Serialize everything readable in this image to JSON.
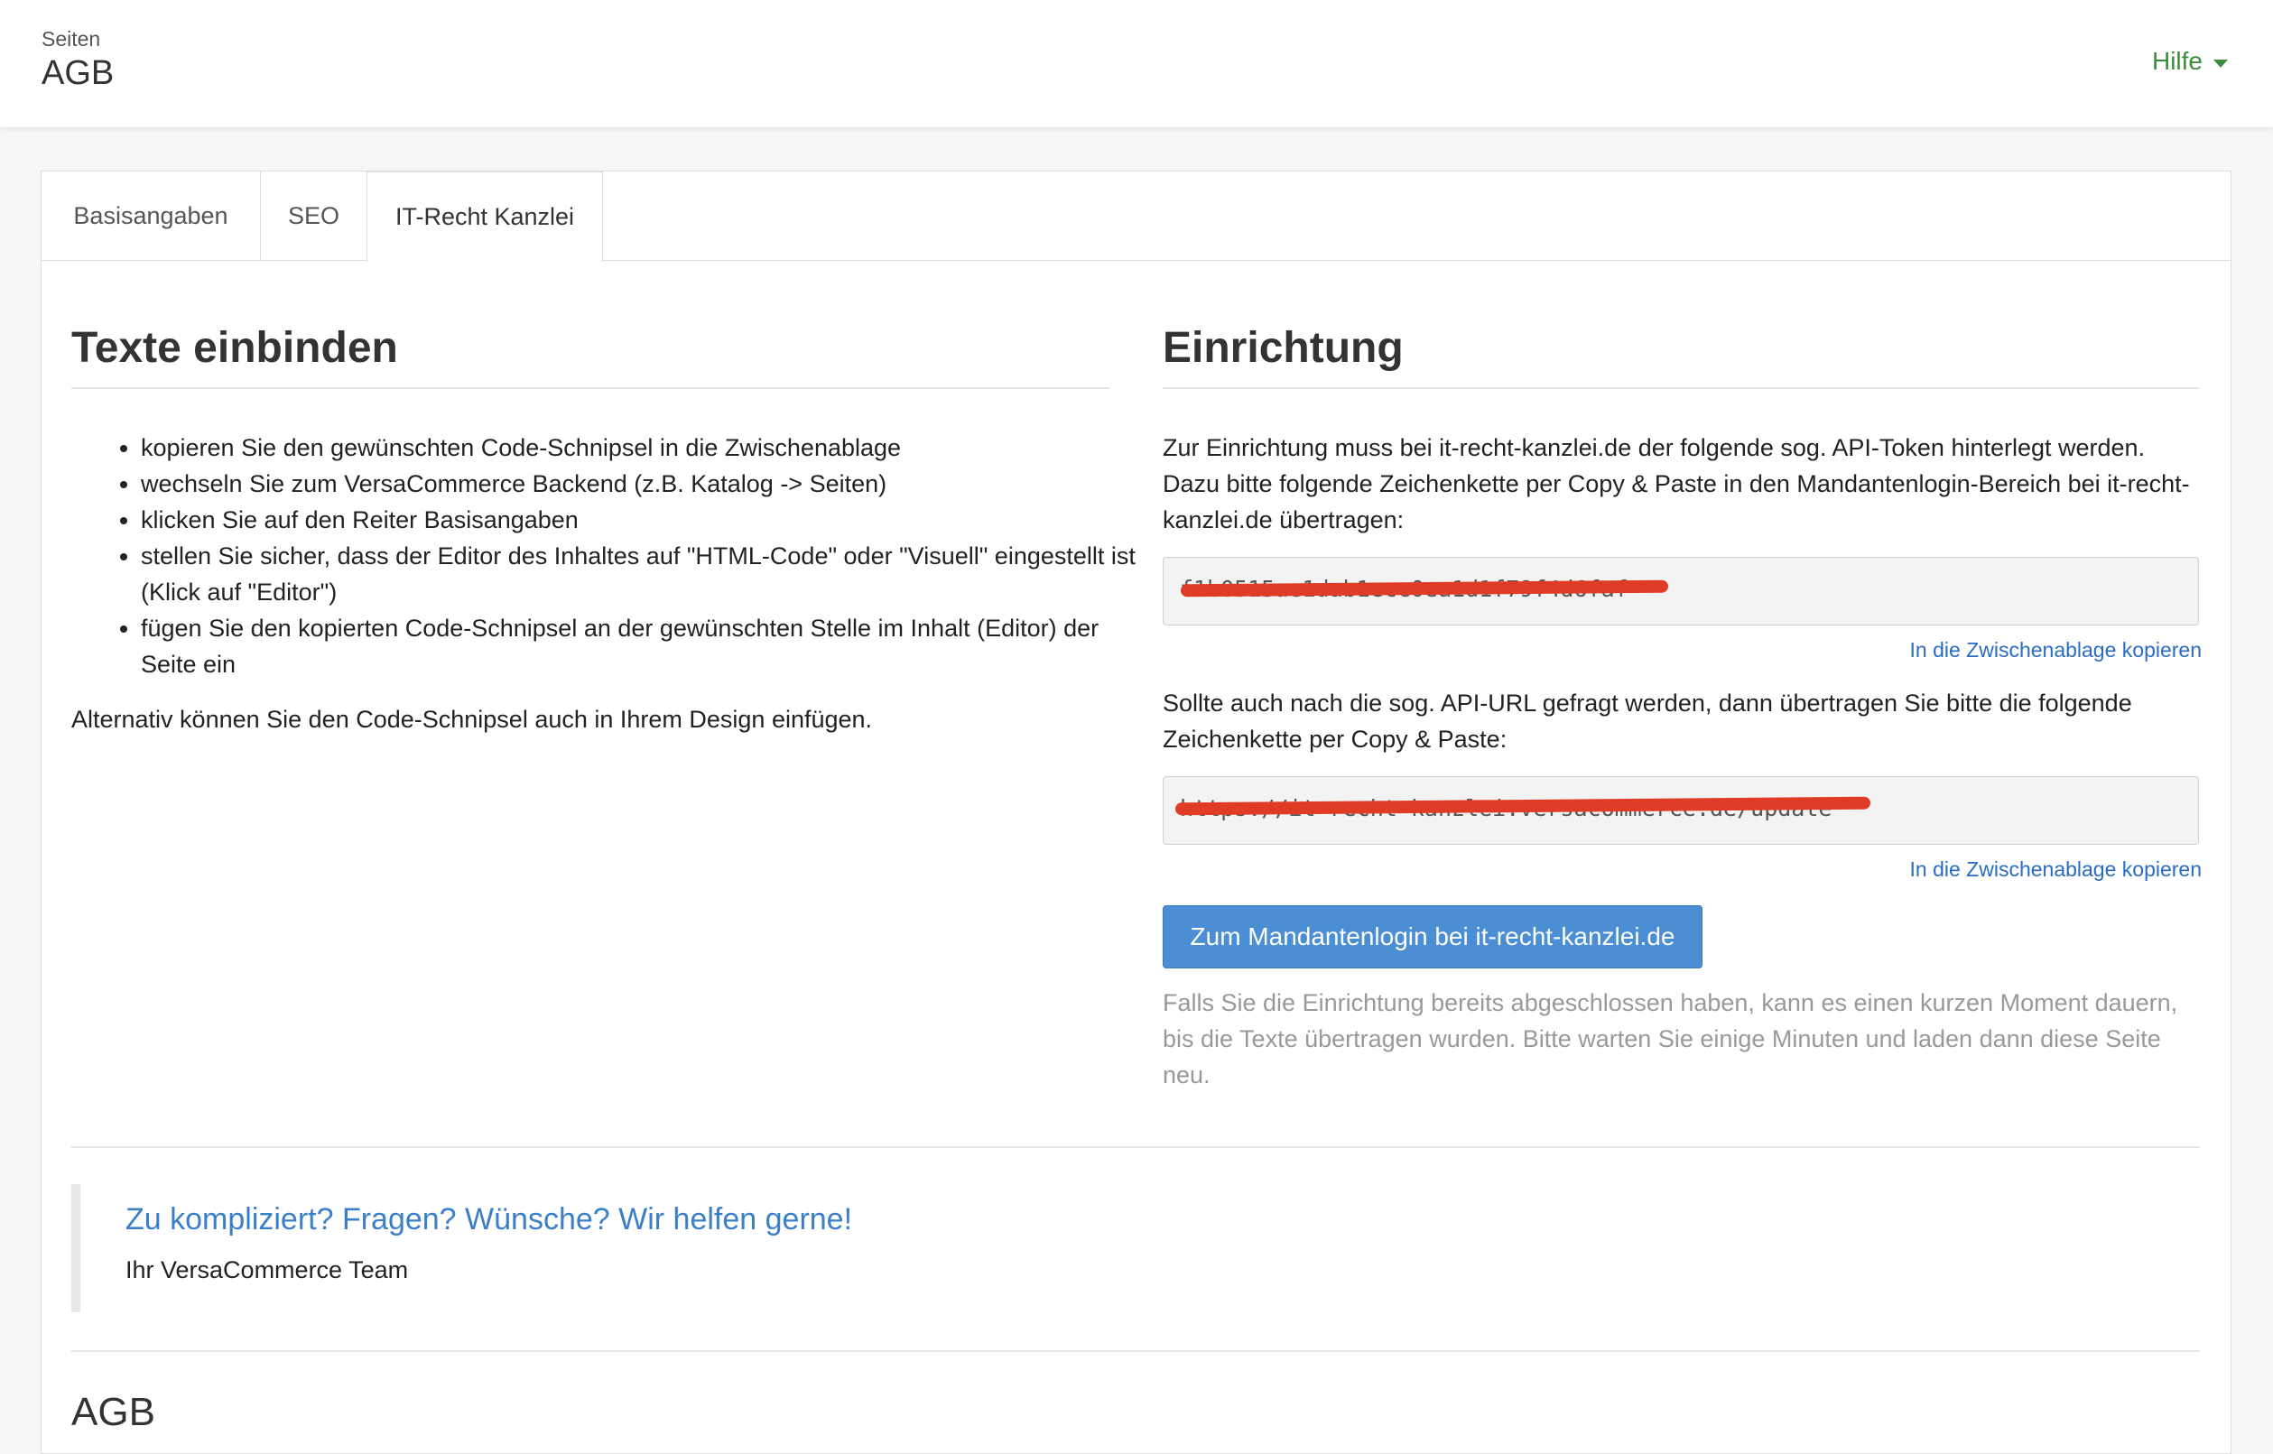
{
  "header": {
    "breadcrumb": "Seiten",
    "title": "AGB",
    "help_label": "Hilfe"
  },
  "tabs": [
    {
      "label": "Basisangaben"
    },
    {
      "label": "SEO"
    },
    {
      "label": "IT-Recht Kanzlei"
    }
  ],
  "left": {
    "heading": "Texte einbinden",
    "items": [
      "kopieren Sie den gewünschten Code-Schnipsel in die Zwischenablage",
      "wechseln Sie zum VersaCommerce Backend (z.B. Katalog -> Seiten)",
      "klicken Sie auf den Reiter Basisangaben",
      "stellen Sie sicher, dass der Editor des Inhaltes auf \"HTML-Code\" oder \"Visuell\" eingestellt ist (Klick auf \"Editor\")",
      "fügen Sie den kopierten Code-Schnipsel an der gewünschten Stelle im Inhalt (Editor) der Seite ein"
    ],
    "alt_text": "Alternativ können Sie den Code-Schnipsel auch in Ihrem Design einfügen."
  },
  "right": {
    "heading": "Einrichtung",
    "intro": "Zur Einrichtung muss bei it-recht-kanzlei.de der folgende sog. API-Token hinterlegt werden. Dazu bitte folgende Zeichenkette per Copy & Paste in den Mandantenlogin-Bereich bei it-recht-kanzlei.de übertragen:",
    "token_value": "f1b0515ae1dab1ecc0ea1d1f79f4d6faf",
    "copy_label": "In die Zwischenablage kopieren",
    "url_intro": "Sollte auch nach die sog. API-URL gefragt werden, dann übertragen Sie bitte die folgende Zeichenkette per Copy & Paste:",
    "url_value": "https://it-recht-kanzlei.versacommerce.de/update",
    "copy_label2": "In die Zwischenablage kopieren",
    "button_label": "Zum Mandantenlogin bei it-recht-kanzlei.de",
    "note": "Falls Sie die Einrichtung bereits abgeschlossen haben, kann es einen kurzen Moment dauern, bis die Texte übertragen wurden. Bitte warten Sie einige Minuten und laden dann diese Seite neu."
  },
  "help_box": {
    "title": "Zu kompliziert? Fragen? Wünsche? Wir helfen gerne!",
    "signature": "Ihr VersaCommerce Team"
  },
  "agb_heading": "AGB",
  "colors": {
    "accent_green": "#3d8b3d",
    "link_blue": "#2a6cc2",
    "button_blue": "#4c8ed4",
    "redaction_red": "#e03b24"
  }
}
